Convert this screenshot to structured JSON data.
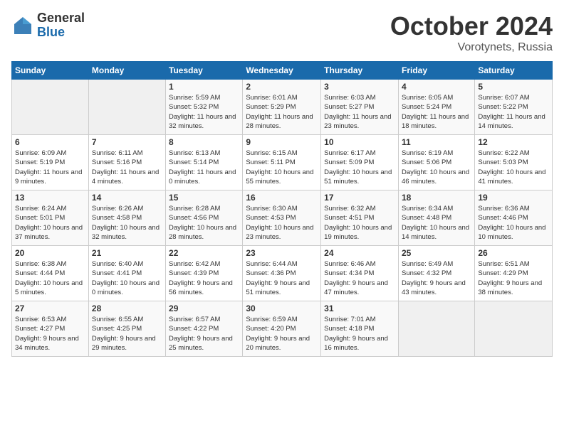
{
  "logo": {
    "general": "General",
    "blue": "Blue"
  },
  "title": "October 2024",
  "location": "Vorotynets, Russia",
  "days_header": [
    "Sunday",
    "Monday",
    "Tuesday",
    "Wednesday",
    "Thursday",
    "Friday",
    "Saturday"
  ],
  "weeks": [
    [
      {
        "day": "",
        "empty": true
      },
      {
        "day": "",
        "empty": true
      },
      {
        "day": "1",
        "sunrise": "Sunrise: 5:59 AM",
        "sunset": "Sunset: 5:32 PM",
        "daylight": "Daylight: 11 hours and 32 minutes."
      },
      {
        "day": "2",
        "sunrise": "Sunrise: 6:01 AM",
        "sunset": "Sunset: 5:29 PM",
        "daylight": "Daylight: 11 hours and 28 minutes."
      },
      {
        "day": "3",
        "sunrise": "Sunrise: 6:03 AM",
        "sunset": "Sunset: 5:27 PM",
        "daylight": "Daylight: 11 hours and 23 minutes."
      },
      {
        "day": "4",
        "sunrise": "Sunrise: 6:05 AM",
        "sunset": "Sunset: 5:24 PM",
        "daylight": "Daylight: 11 hours and 18 minutes."
      },
      {
        "day": "5",
        "sunrise": "Sunrise: 6:07 AM",
        "sunset": "Sunset: 5:22 PM",
        "daylight": "Daylight: 11 hours and 14 minutes."
      }
    ],
    [
      {
        "day": "6",
        "sunrise": "Sunrise: 6:09 AM",
        "sunset": "Sunset: 5:19 PM",
        "daylight": "Daylight: 11 hours and 9 minutes."
      },
      {
        "day": "7",
        "sunrise": "Sunrise: 6:11 AM",
        "sunset": "Sunset: 5:16 PM",
        "daylight": "Daylight: 11 hours and 4 minutes."
      },
      {
        "day": "8",
        "sunrise": "Sunrise: 6:13 AM",
        "sunset": "Sunset: 5:14 PM",
        "daylight": "Daylight: 11 hours and 0 minutes."
      },
      {
        "day": "9",
        "sunrise": "Sunrise: 6:15 AM",
        "sunset": "Sunset: 5:11 PM",
        "daylight": "Daylight: 10 hours and 55 minutes."
      },
      {
        "day": "10",
        "sunrise": "Sunrise: 6:17 AM",
        "sunset": "Sunset: 5:09 PM",
        "daylight": "Daylight: 10 hours and 51 minutes."
      },
      {
        "day": "11",
        "sunrise": "Sunrise: 6:19 AM",
        "sunset": "Sunset: 5:06 PM",
        "daylight": "Daylight: 10 hours and 46 minutes."
      },
      {
        "day": "12",
        "sunrise": "Sunrise: 6:22 AM",
        "sunset": "Sunset: 5:03 PM",
        "daylight": "Daylight: 10 hours and 41 minutes."
      }
    ],
    [
      {
        "day": "13",
        "sunrise": "Sunrise: 6:24 AM",
        "sunset": "Sunset: 5:01 PM",
        "daylight": "Daylight: 10 hours and 37 minutes."
      },
      {
        "day": "14",
        "sunrise": "Sunrise: 6:26 AM",
        "sunset": "Sunset: 4:58 PM",
        "daylight": "Daylight: 10 hours and 32 minutes."
      },
      {
        "day": "15",
        "sunrise": "Sunrise: 6:28 AM",
        "sunset": "Sunset: 4:56 PM",
        "daylight": "Daylight: 10 hours and 28 minutes."
      },
      {
        "day": "16",
        "sunrise": "Sunrise: 6:30 AM",
        "sunset": "Sunset: 4:53 PM",
        "daylight": "Daylight: 10 hours and 23 minutes."
      },
      {
        "day": "17",
        "sunrise": "Sunrise: 6:32 AM",
        "sunset": "Sunset: 4:51 PM",
        "daylight": "Daylight: 10 hours and 19 minutes."
      },
      {
        "day": "18",
        "sunrise": "Sunrise: 6:34 AM",
        "sunset": "Sunset: 4:48 PM",
        "daylight": "Daylight: 10 hours and 14 minutes."
      },
      {
        "day": "19",
        "sunrise": "Sunrise: 6:36 AM",
        "sunset": "Sunset: 4:46 PM",
        "daylight": "Daylight: 10 hours and 10 minutes."
      }
    ],
    [
      {
        "day": "20",
        "sunrise": "Sunrise: 6:38 AM",
        "sunset": "Sunset: 4:44 PM",
        "daylight": "Daylight: 10 hours and 5 minutes."
      },
      {
        "day": "21",
        "sunrise": "Sunrise: 6:40 AM",
        "sunset": "Sunset: 4:41 PM",
        "daylight": "Daylight: 10 hours and 0 minutes."
      },
      {
        "day": "22",
        "sunrise": "Sunrise: 6:42 AM",
        "sunset": "Sunset: 4:39 PM",
        "daylight": "Daylight: 9 hours and 56 minutes."
      },
      {
        "day": "23",
        "sunrise": "Sunrise: 6:44 AM",
        "sunset": "Sunset: 4:36 PM",
        "daylight": "Daylight: 9 hours and 51 minutes."
      },
      {
        "day": "24",
        "sunrise": "Sunrise: 6:46 AM",
        "sunset": "Sunset: 4:34 PM",
        "daylight": "Daylight: 9 hours and 47 minutes."
      },
      {
        "day": "25",
        "sunrise": "Sunrise: 6:49 AM",
        "sunset": "Sunset: 4:32 PM",
        "daylight": "Daylight: 9 hours and 43 minutes."
      },
      {
        "day": "26",
        "sunrise": "Sunrise: 6:51 AM",
        "sunset": "Sunset: 4:29 PM",
        "daylight": "Daylight: 9 hours and 38 minutes."
      }
    ],
    [
      {
        "day": "27",
        "sunrise": "Sunrise: 6:53 AM",
        "sunset": "Sunset: 4:27 PM",
        "daylight": "Daylight: 9 hours and 34 minutes."
      },
      {
        "day": "28",
        "sunrise": "Sunrise: 6:55 AM",
        "sunset": "Sunset: 4:25 PM",
        "daylight": "Daylight: 9 hours and 29 minutes."
      },
      {
        "day": "29",
        "sunrise": "Sunrise: 6:57 AM",
        "sunset": "Sunset: 4:22 PM",
        "daylight": "Daylight: 9 hours and 25 minutes."
      },
      {
        "day": "30",
        "sunrise": "Sunrise: 6:59 AM",
        "sunset": "Sunset: 4:20 PM",
        "daylight": "Daylight: 9 hours and 20 minutes."
      },
      {
        "day": "31",
        "sunrise": "Sunrise: 7:01 AM",
        "sunset": "Sunset: 4:18 PM",
        "daylight": "Daylight: 9 hours and 16 minutes."
      },
      {
        "day": "",
        "empty": true
      },
      {
        "day": "",
        "empty": true
      }
    ]
  ]
}
